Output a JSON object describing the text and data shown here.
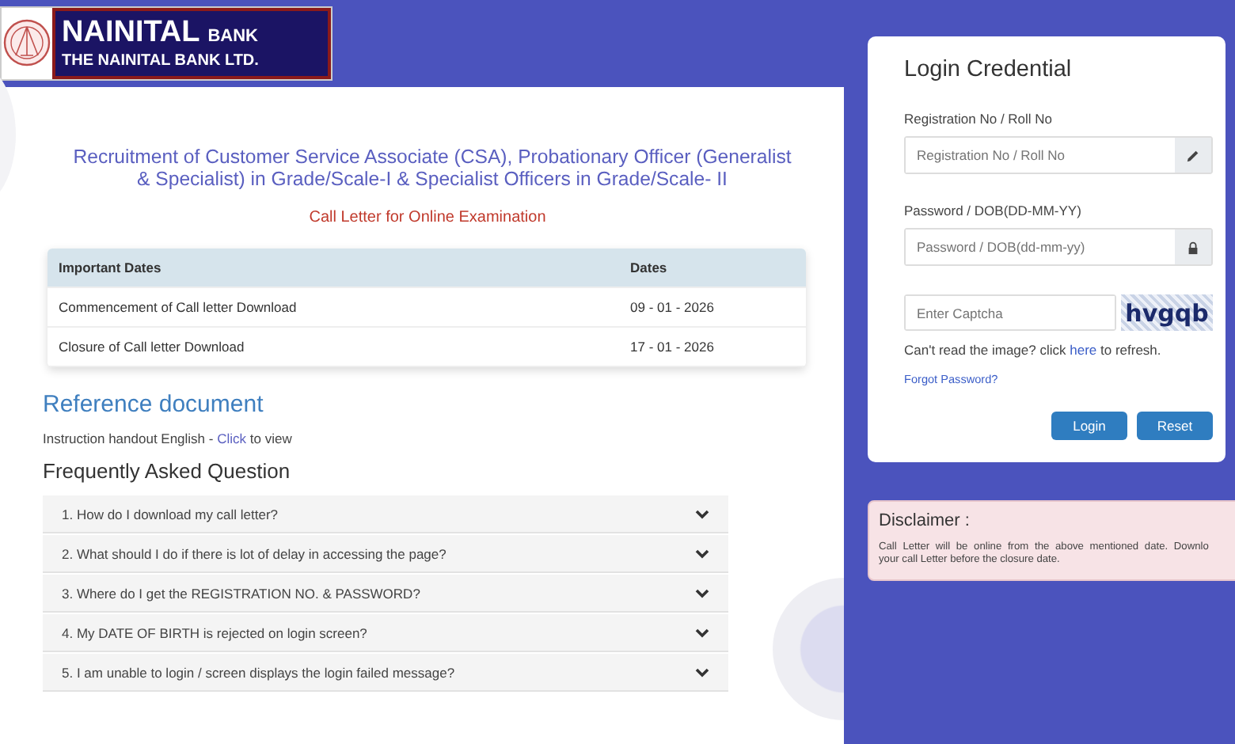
{
  "logo": {
    "title": "NAINITAL",
    "title_suffix": "BANK",
    "subtitle": "THE NAINITAL BANK LTD."
  },
  "heading": "Recruitment of Customer Service Associate (CSA), Probationary Officer (Generalist & Specialist) in Grade/Scale-I & Specialist Officers in Grade/Scale- II",
  "subheading": "Call Letter for Online Examination",
  "dates_table": {
    "columns": [
      "Important Dates",
      "Dates"
    ],
    "rows": [
      [
        "Commencement of Call letter Download",
        "09 - 01 - 2026"
      ],
      [
        "Closure of Call letter Download",
        "17 - 01 - 2026"
      ]
    ]
  },
  "reference": {
    "title": "Reference document",
    "text_before": "Instruction handout English - ",
    "link": "Click",
    "text_after": " to view"
  },
  "faq": {
    "title": "Frequently Asked Question",
    "items": [
      {
        "question": "1. How do I download my call letter?",
        "expanded": false
      },
      {
        "question": "2. What should I do if there is lot of delay in accessing the page?",
        "expanded": false
      },
      {
        "question": "3. Where do I get the REGISTRATION NO. & PASSWORD?",
        "expanded": false
      },
      {
        "question": "4. My DATE OF BIRTH is rejected on login screen?",
        "expanded": false
      },
      {
        "question": "5. I am unable to login / screen displays the login failed message?",
        "expanded": false
      }
    ]
  },
  "login": {
    "title": "Login Credential",
    "fields": [
      {
        "label": "Registration No / Roll No",
        "placeholder": "Registration No / Roll No",
        "kind": "pencil"
      },
      {
        "label": "Password / DOB(DD-MM-YY)",
        "placeholder": "Password / DOB(dd-mm-yy)",
        "kind": "lock"
      }
    ],
    "captcha": {
      "placeholder": "Enter Captcha",
      "code": "hvgqb"
    },
    "refresh": {
      "before": "Can't read the image? click ",
      "link": "here",
      "after": " to refresh."
    },
    "forgot": "Forgot Password?",
    "buttons": [
      "Login",
      "Reset"
    ]
  },
  "disclaimer": {
    "title": "Disclaimer :",
    "lines": [
      "Call Letter will be online from the above mentioned date. Downlo",
      "your call Letter before the closure date."
    ]
  }
}
